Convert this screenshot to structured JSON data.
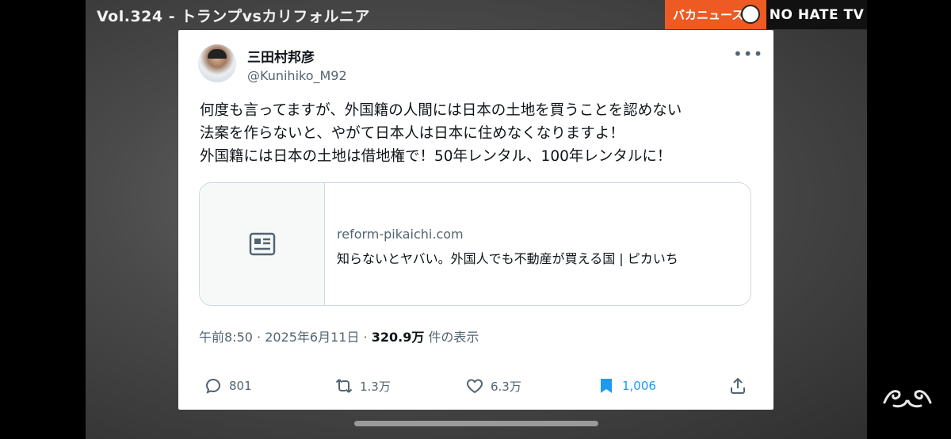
{
  "video": {
    "episode_title": "Vol.324 -  トランプvsカリフォルニア",
    "brand_label": "バカニュース",
    "channel_label": "NO HATE TV"
  },
  "tweet": {
    "author_name": "三田村邦彦",
    "author_handle": "@Kunihiko_M92",
    "more_icon": "more-icon",
    "text_lines": [
      "何度も言ってますが、外国籍の人間には日本の土地を買うことを認めない",
      "法案を作らないと、やがて日本人は日本に住めなくなりますよ！",
      "外国籍には日本の土地は借地権で！50年レンタル、100年レンタルに！"
    ],
    "link_card": {
      "icon": "article-icon",
      "domain": "reform-pikaichi.com",
      "title": "知らないとヤバい。外国人でも不動産が買える国 | ピカいち"
    },
    "meta": {
      "time_date": "午前8:50 · 2025年6月11日 · ",
      "views_value": "320.9万",
      "views_suffix": " 件の表示"
    },
    "actions": {
      "replies": "801",
      "retweets": "1.3万",
      "likes": "6.3万",
      "bookmarks": "1,006"
    },
    "colors": {
      "accent_blue": "#1d9bf0",
      "secondary_text": "#536471",
      "brand_orange": "#ee5a24"
    }
  }
}
